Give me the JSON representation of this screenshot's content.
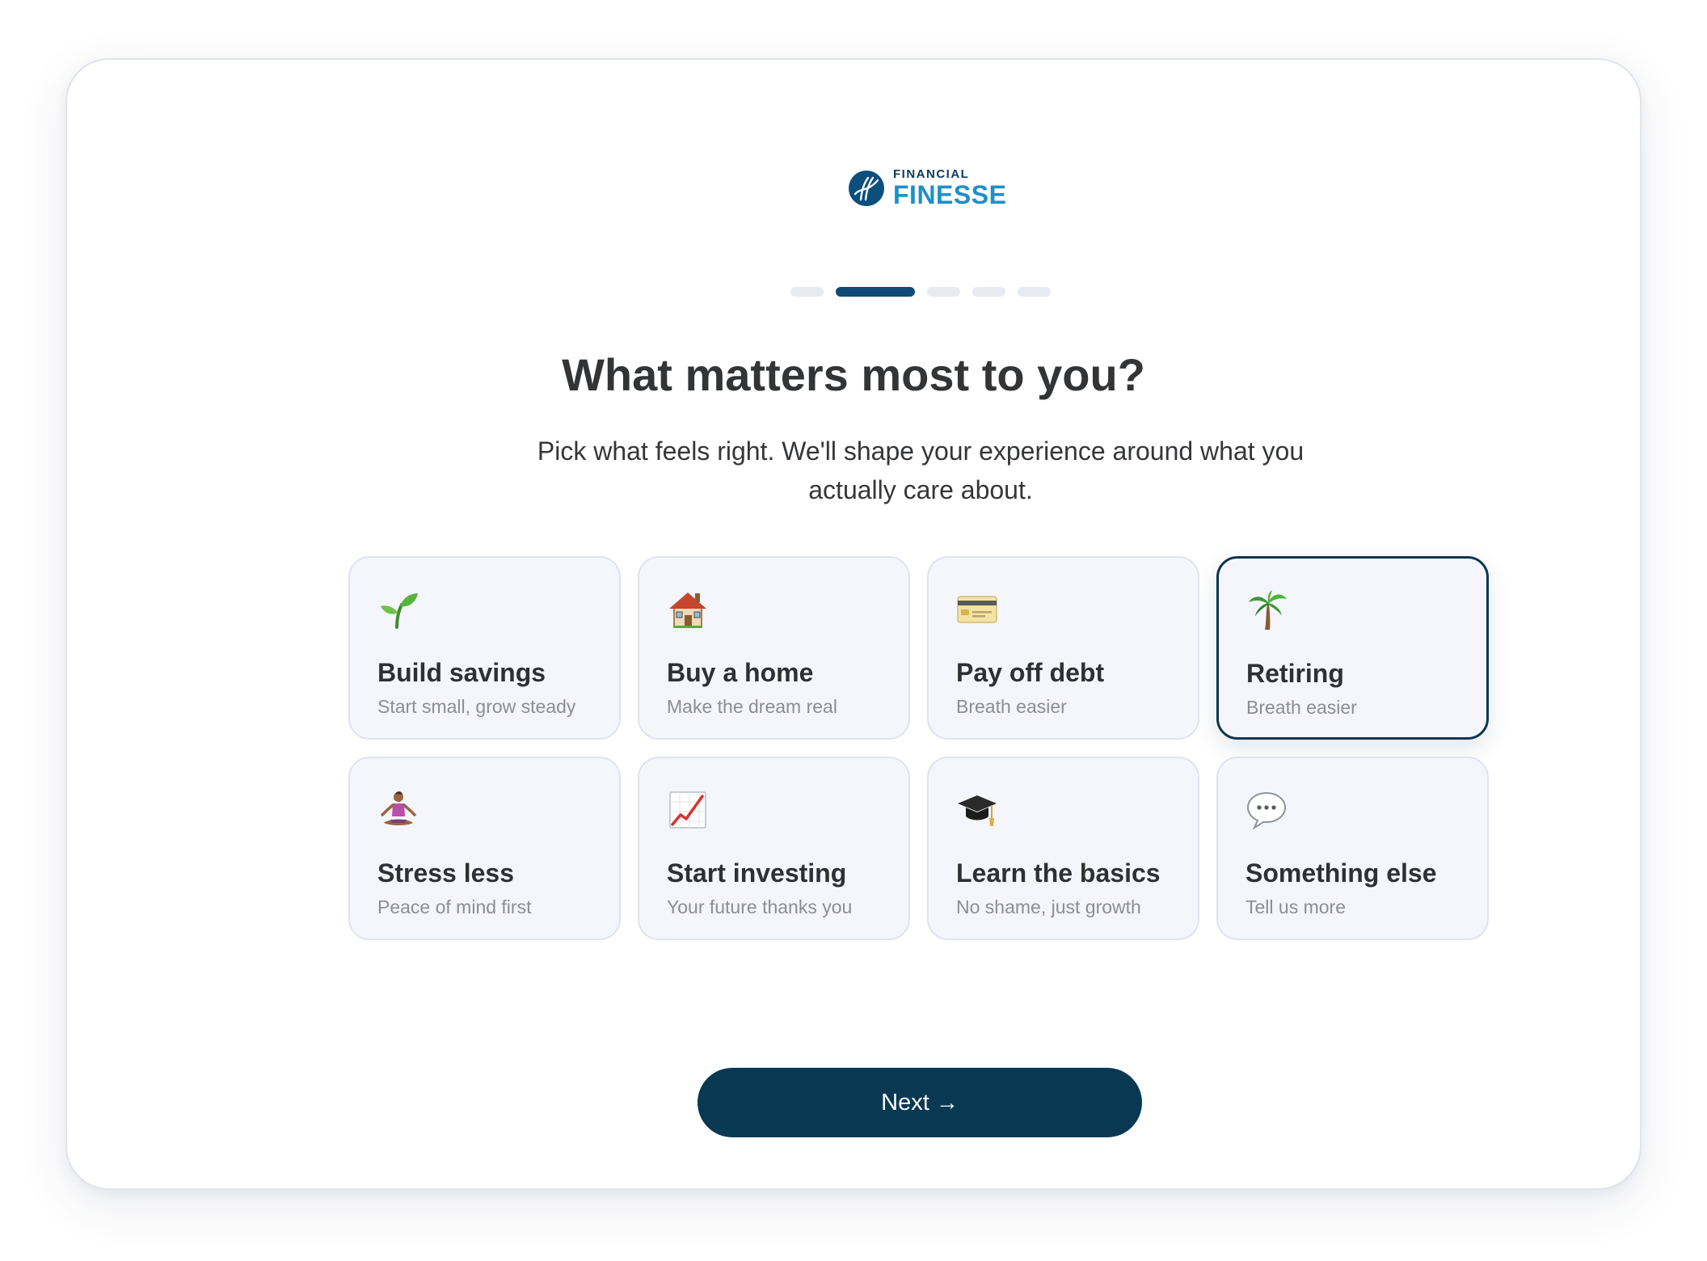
{
  "logo": {
    "line1": "FINANCIAL",
    "line2": "FINESSE",
    "colors": {
      "dark": "#0b3c5d",
      "accent": "#1f8fc9"
    }
  },
  "stepper": {
    "total_steps": 5,
    "current_step": 2
  },
  "heading": "What matters most to you?",
  "subheading": "Pick what feels right. We'll shape your experience around what you actually care about.",
  "options": [
    {
      "icon": "seedling-icon",
      "label": "Build savings",
      "sub": "Start small, grow steady",
      "selected": false
    },
    {
      "icon": "house-icon",
      "label": "Buy a home",
      "sub": "Make the dream real",
      "selected": false
    },
    {
      "icon": "credit-card-icon",
      "label": "Pay off debt",
      "sub": "Breath easier",
      "selected": false
    },
    {
      "icon": "palm-tree-icon",
      "label": "Retiring",
      "sub": "Breath easier",
      "selected": true
    },
    {
      "icon": "meditation-icon",
      "label": "Stress less",
      "sub": "Peace of mind first",
      "selected": false
    },
    {
      "icon": "chart-increasing-icon",
      "label": "Start investing",
      "sub": "Your future thanks you",
      "selected": false
    },
    {
      "icon": "graduation-cap-icon",
      "label": "Learn the basics",
      "sub": "No shame, just growth",
      "selected": false
    },
    {
      "icon": "speech-bubble-icon",
      "label": "Something else",
      "sub": "Tell us more",
      "selected": false
    }
  ],
  "next_button": {
    "label": "Next",
    "arrow": "→"
  },
  "colors": {
    "primary": "#093852",
    "card_bg": "#f4f6fc",
    "card_border": "#dfe3ee",
    "selected_border": "#0b3550"
  }
}
